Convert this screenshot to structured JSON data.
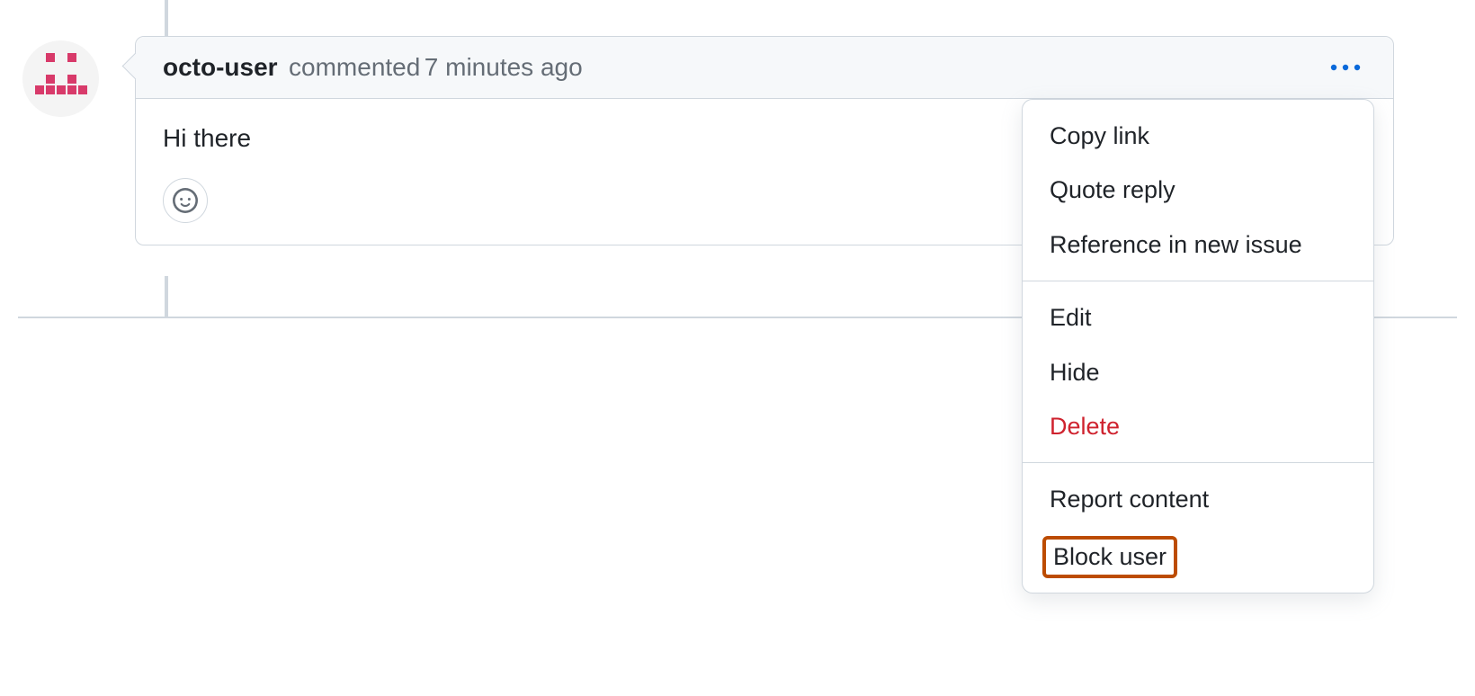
{
  "comment": {
    "author": "octo-user",
    "action": "commented",
    "timestamp": "7 minutes ago",
    "body": "Hi there"
  },
  "icons": {
    "kebab": "kebab-horizontal-icon",
    "reaction": "smiley-icon"
  },
  "menu": {
    "copy_link": "Copy link",
    "quote_reply": "Quote reply",
    "reference_new_issue": "Reference in new issue",
    "edit": "Edit",
    "hide": "Hide",
    "delete": "Delete",
    "report_content": "Report content",
    "block_user": "Block user"
  }
}
